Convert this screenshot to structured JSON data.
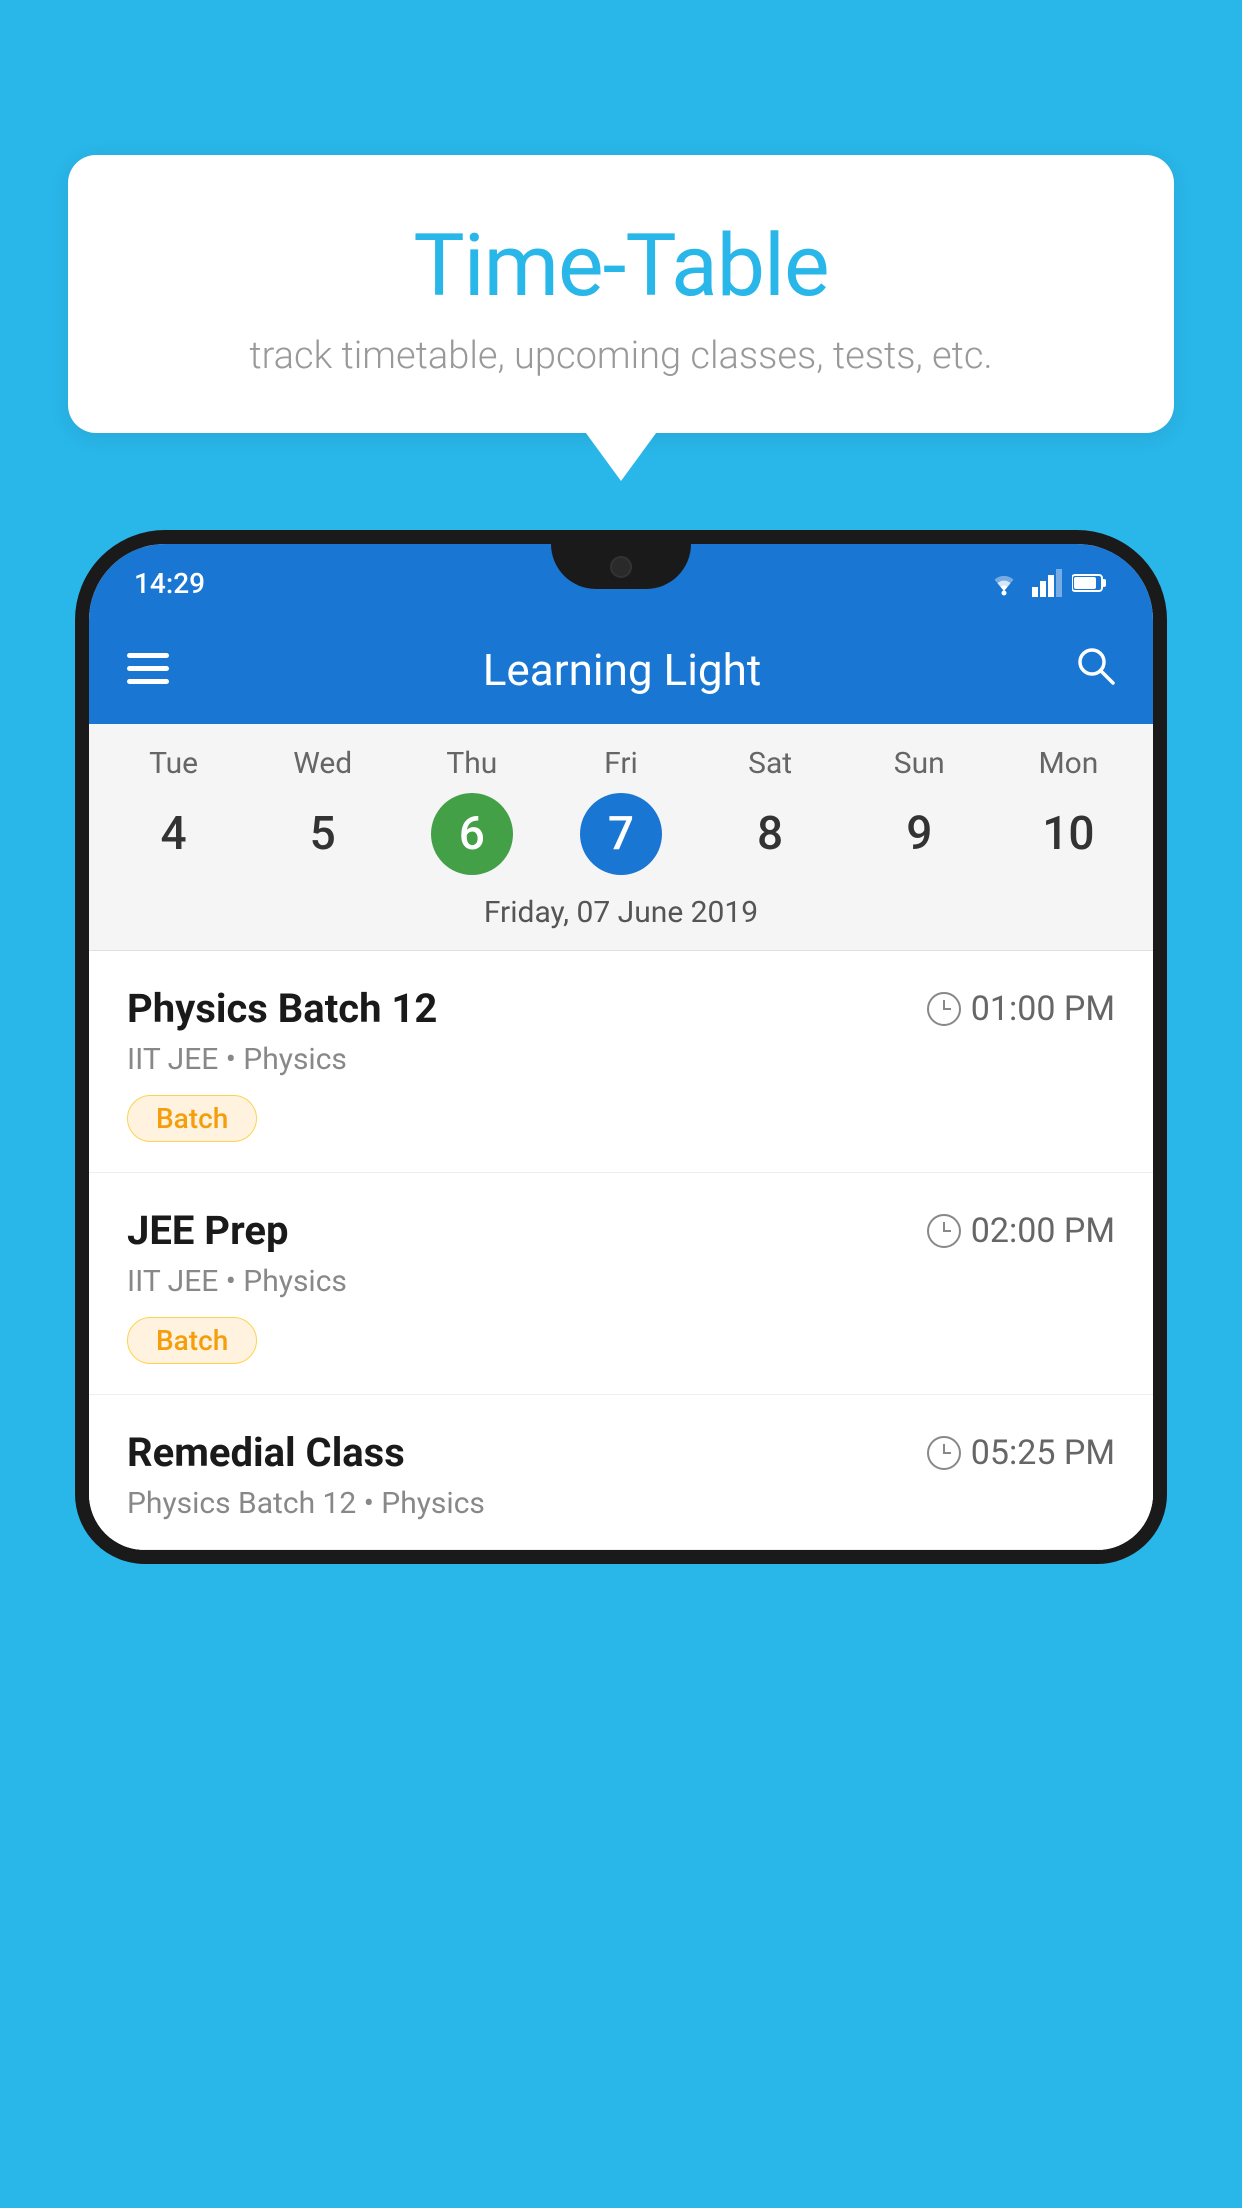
{
  "background": {
    "color": "#29b6e8"
  },
  "tooltip": {
    "title": "Time-Table",
    "subtitle": "track timetable, upcoming classes, tests, etc."
  },
  "app": {
    "toolbar": {
      "title": "Learning Light",
      "menu_icon": "≡",
      "search_icon": "🔍"
    },
    "status_bar": {
      "time": "14:29"
    },
    "calendar": {
      "selected_date_label": "Friday, 07 June 2019",
      "days": [
        {
          "name": "Tue",
          "num": "4",
          "state": "normal"
        },
        {
          "name": "Wed",
          "num": "5",
          "state": "normal"
        },
        {
          "name": "Thu",
          "num": "6",
          "state": "today"
        },
        {
          "name": "Fri",
          "num": "7",
          "state": "selected"
        },
        {
          "name": "Sat",
          "num": "8",
          "state": "normal"
        },
        {
          "name": "Sun",
          "num": "9",
          "state": "normal"
        },
        {
          "name": "Mon",
          "num": "10",
          "state": "normal"
        }
      ]
    },
    "schedule": [
      {
        "name": "Physics Batch 12",
        "time": "01:00 PM",
        "meta": "IIT JEE • Physics",
        "badge": "Batch"
      },
      {
        "name": "JEE Prep",
        "time": "02:00 PM",
        "meta": "IIT JEE • Physics",
        "badge": "Batch"
      },
      {
        "name": "Remedial Class",
        "time": "05:25 PM",
        "meta": "Physics Batch 12 • Physics",
        "badge": null
      }
    ]
  }
}
